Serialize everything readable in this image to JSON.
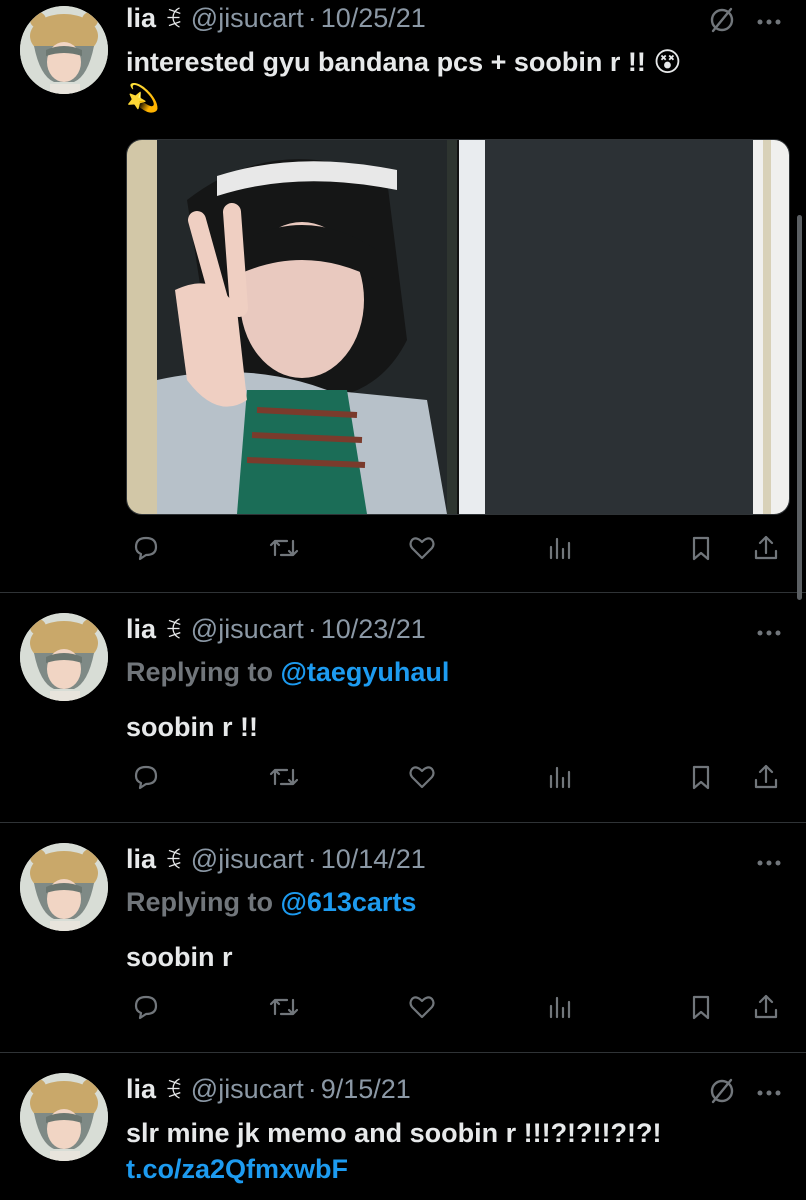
{
  "author": {
    "name": "lia",
    "name_deco": "ꉂ",
    "handle": "@jisucart"
  },
  "dot": "·",
  "tweets": [
    {
      "date": "10/25/21",
      "replying_prefix": "",
      "replying_to": "",
      "text": "interested gyu bandana pcs + soobin r !! 😵",
      "text_line2": "💫",
      "link": ""
    },
    {
      "date": "10/23/21",
      "replying_prefix": "Replying to",
      "replying_to": "@taegyuhaul",
      "text": "soobin r !!",
      "text_line2": "",
      "link": ""
    },
    {
      "date": "10/14/21",
      "replying_prefix": "Replying to",
      "replying_to": "@613carts",
      "text": "soobin r",
      "text_line2": "",
      "link": ""
    },
    {
      "date": "9/15/21",
      "replying_prefix": "",
      "replying_to": "",
      "text": "slr mine jk memo and soobin r !!!?!?!!?!?!",
      "text_line2": "",
      "link": "t.co/za2QfmxwbF"
    }
  ],
  "icons": {
    "reply": "reply-icon",
    "retweet": "retweet-icon",
    "like": "like-icon",
    "views": "views-icon",
    "bookmark": "bookmark-icon",
    "share": "share-icon",
    "more": "more-icon",
    "grok": "grok-icon"
  },
  "colors": {
    "background": "#000000",
    "text": "#e7e9ea",
    "secondary": "#71767b",
    "accent": "#1d9bf0",
    "divider": "#2f3336"
  }
}
